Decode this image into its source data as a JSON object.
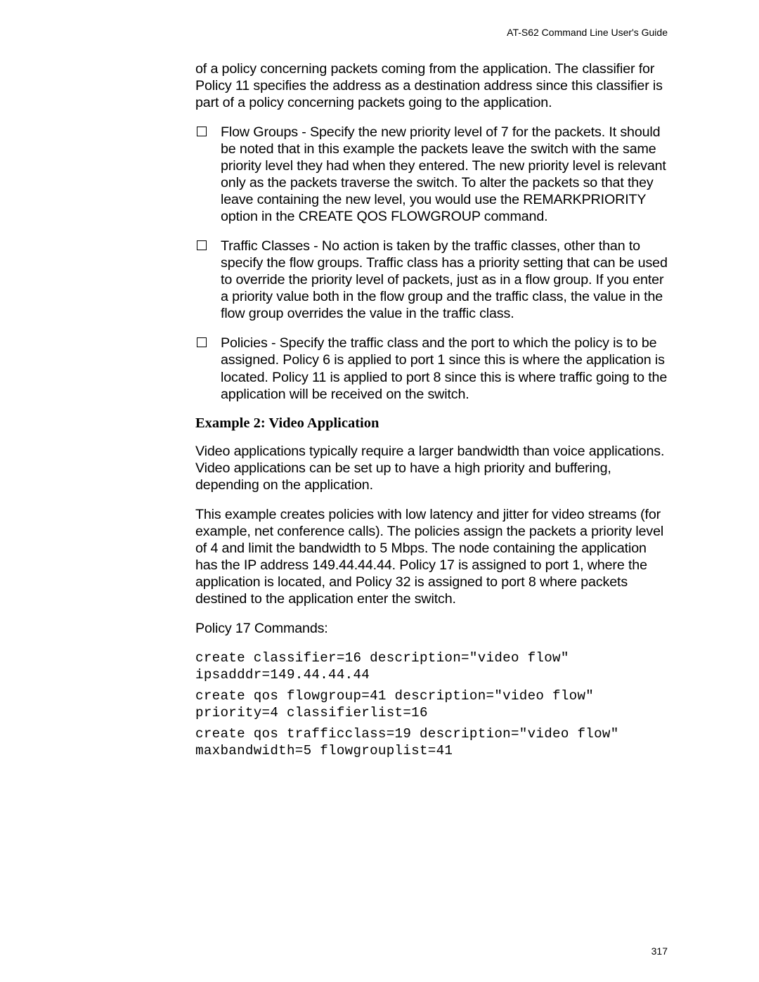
{
  "running_head": "AT-S62 Command Line User's Guide",
  "intro_trail": "of a policy concerning packets coming from the application. The classifier for Policy 11 specifies the address as a destination address since this classifier is part of a policy concerning packets going to the application.",
  "bullets": [
    "Flow Groups - Specify the new priority level of 7 for the packets. It should be noted that in this example the packets leave the switch with the same priority level they had when they entered. The new priority level is relevant only as the packets traverse the switch. To alter the packets so that they leave containing the new level, you would use the REMARKPRIORITY option in the CREATE QOS FLOWGROUP command.",
    "Traffic Classes - No action is taken by the traffic classes, other than to specify the flow groups. Traffic class has a priority setting that can be used to override the priority level of packets, just as in a flow group. If you enter a priority value both in the flow group and the traffic class, the value in the flow group overrides the value in the traffic class.",
    "Policies - Specify the traffic class and the port to which the policy is to be assigned. Policy 6 is applied to port 1 since this is where the application is located. Policy 11 is applied to port 8 since this is where traffic going to the application will be received on the switch."
  ],
  "heading": "Example 2: Video Application",
  "para1": "Video applications typically require a larger bandwidth than voice applications. Video applications can be set up to have a high priority and buffering, depending on the application.",
  "para2": "This example creates policies with low latency and jitter for video streams (for example, net conference calls). The policies assign the packets a priority level of 4 and limit the bandwidth to 5 Mbps. The node containing the application has the IP address 149.44.44.44. Policy 17 is assigned to port 1, where the application is located, and Policy 32 is assigned to port 8 where packets destined to the application enter the switch.",
  "para3": "Policy 17 Commands:",
  "code1": "create classifier=16 description=\"video flow\" ipsadddr=149.44.44.44",
  "code2": "create qos flowgroup=41 description=\"video flow\" priority=4 classifierlist=16",
  "code3": "create qos trafficclass=19 description=\"video flow\" maxbandwidth=5 flowgrouplist=41",
  "page_number": "317"
}
